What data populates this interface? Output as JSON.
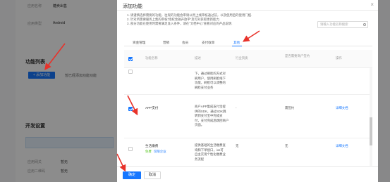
{
  "background": {
    "labels": [
      "应用名称",
      "应用类型"
    ],
    "values": [
      "糖卖出售",
      "Android"
    ],
    "section_feature_list": "功能列表",
    "add_feature_button": "+ 添加功能",
    "add_feature_note": "暂已经添加功能功能",
    "section_dev_settings": "开发设置",
    "info_lines": [
      "应用网关",
      "应用二维码"
    ],
    "info_values": [
      "暂无",
      "暂无"
    ]
  },
  "modal": {
    "title": "添加功能",
    "close_glyph": "×",
    "notice": [
      "1. 请谨慎选择需要的功能，往现的功能会审请公用上线审核通过前，以及使用后的使用门槛.",
      "2. 针对所需要服务上集的审核“授权金融开放平”及可对获取更新能力.",
      "3. 部分功能在使用时需要满足准入条件，请在“文档中心”查看对应的产品说明."
    ],
    "search_placeholder": "请输入功能名称搜索",
    "tabs": [
      "资金管理",
      "营销",
      "会员",
      "支付收单",
      "其他"
    ],
    "active_tab_index": 4,
    "table": {
      "headers": [
        "功能名称",
        "描述",
        "行业资质",
        "是否需要商户签约",
        "操作"
      ],
      "rows": [
        {
          "checked": false,
          "name": "",
          "description": [
            "下，通过刷脸的方式对",
            "刷用户，使用刷脸线下",
            "功能，刷脸可以调整的",
            "刷脸支付业务"
          ],
          "qualification": "",
          "contract": "",
          "action": ""
        },
        {
          "checked": true,
          "name": "APP支付",
          "description": [
            "商户APP集成支付宝提",
            "供的SDK，通过SDK跳",
            "转到支付宝中完成支",
            "付，支付完成后跳回商户",
            "页面。"
          ],
          "qualification": "-",
          "contract": "需签约",
          "action": "详细文档"
        },
        {
          "checked": false,
          "name": "生活缴费",
          "tags": [
            "免费",
            "仅限企业"
          ],
          "description": [
            "提供基础的生活缴费查",
            "询和下单接口，ios可",
            "自主实现个性化缴费业",
            "务流程"
          ],
          "qualification": "无",
          "contract": "无",
          "action": "详细文档"
        }
      ]
    },
    "ok_label": "确定",
    "cancel_label": "取消"
  },
  "colors": {
    "accent": "#1677ff",
    "annotation_arrow": "#e8322a",
    "overlay": "rgba(0,0,0,0.45)"
  },
  "icons": [
    "close-icon",
    "search-icon",
    "check-icon"
  ]
}
